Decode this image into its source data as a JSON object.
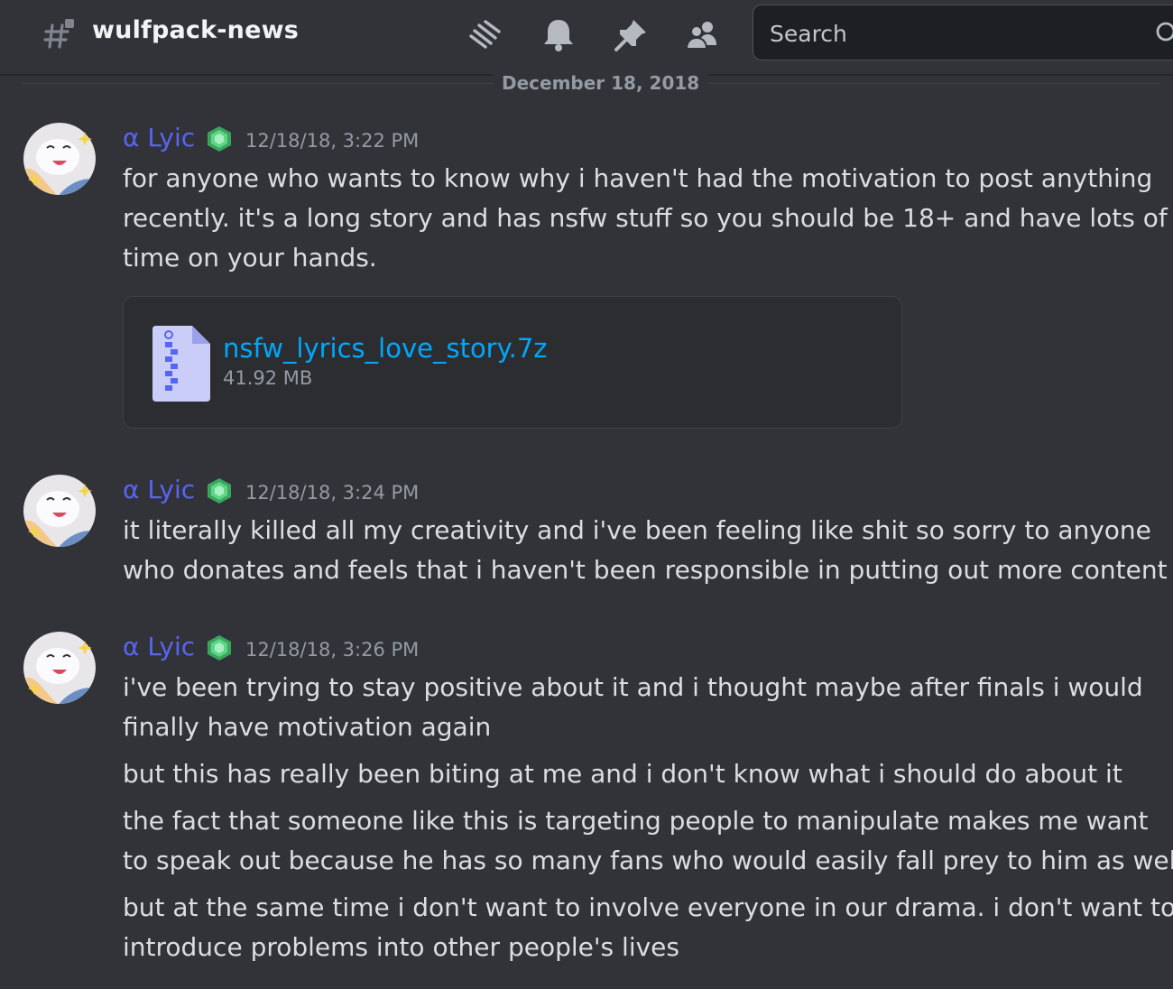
{
  "header": {
    "channel_name": "wulfpack-news",
    "icons": [
      "threads-icon",
      "bell-icon",
      "pin-icon",
      "members-icon"
    ],
    "search_placeholder": "Search"
  },
  "date_divider": "December 18, 2018",
  "colors": {
    "background": "#313338",
    "username": "#5865f2",
    "link": "#00a8fc",
    "badge": "#3ba55c"
  },
  "messages": [
    {
      "author": "α Lyic",
      "timestamp": "12/18/18, 3:22 PM",
      "lines": [
        "for anyone who wants to know why i haven't had the motivation to post anything",
        "recently. it's a long story and has nsfw stuff so you should be 18+ and have lots of",
        "time on your hands."
      ],
      "attachment": {
        "file_name": "nsfw_lyrics_love_story.7z",
        "file_size": "41.92 MB"
      }
    },
    {
      "author": "α Lyic",
      "timestamp": "12/18/18, 3:24 PM",
      "lines": [
        "it literally killed all my creativity and i've been feeling like shit so sorry to anyone",
        "who donates and feels that i haven't been responsible in putting out more content"
      ]
    },
    {
      "author": "α Lyic",
      "timestamp": "12/18/18, 3:26 PM",
      "lines": [
        "i've been trying to stay positive about it and i thought maybe after finals i would",
        "finally have motivation again"
      ],
      "followups": [
        [
          "but this has really been biting at me and i don't know what i should do about it"
        ],
        [
          "the fact that someone like this is targeting people to manipulate makes me want",
          "to speak out because he has so many fans who would easily fall prey to him as well"
        ],
        [
          "but at the same time i don't want to involve everyone in our drama. i don't want to",
          "introduce problems into other people's lives"
        ]
      ]
    }
  ]
}
